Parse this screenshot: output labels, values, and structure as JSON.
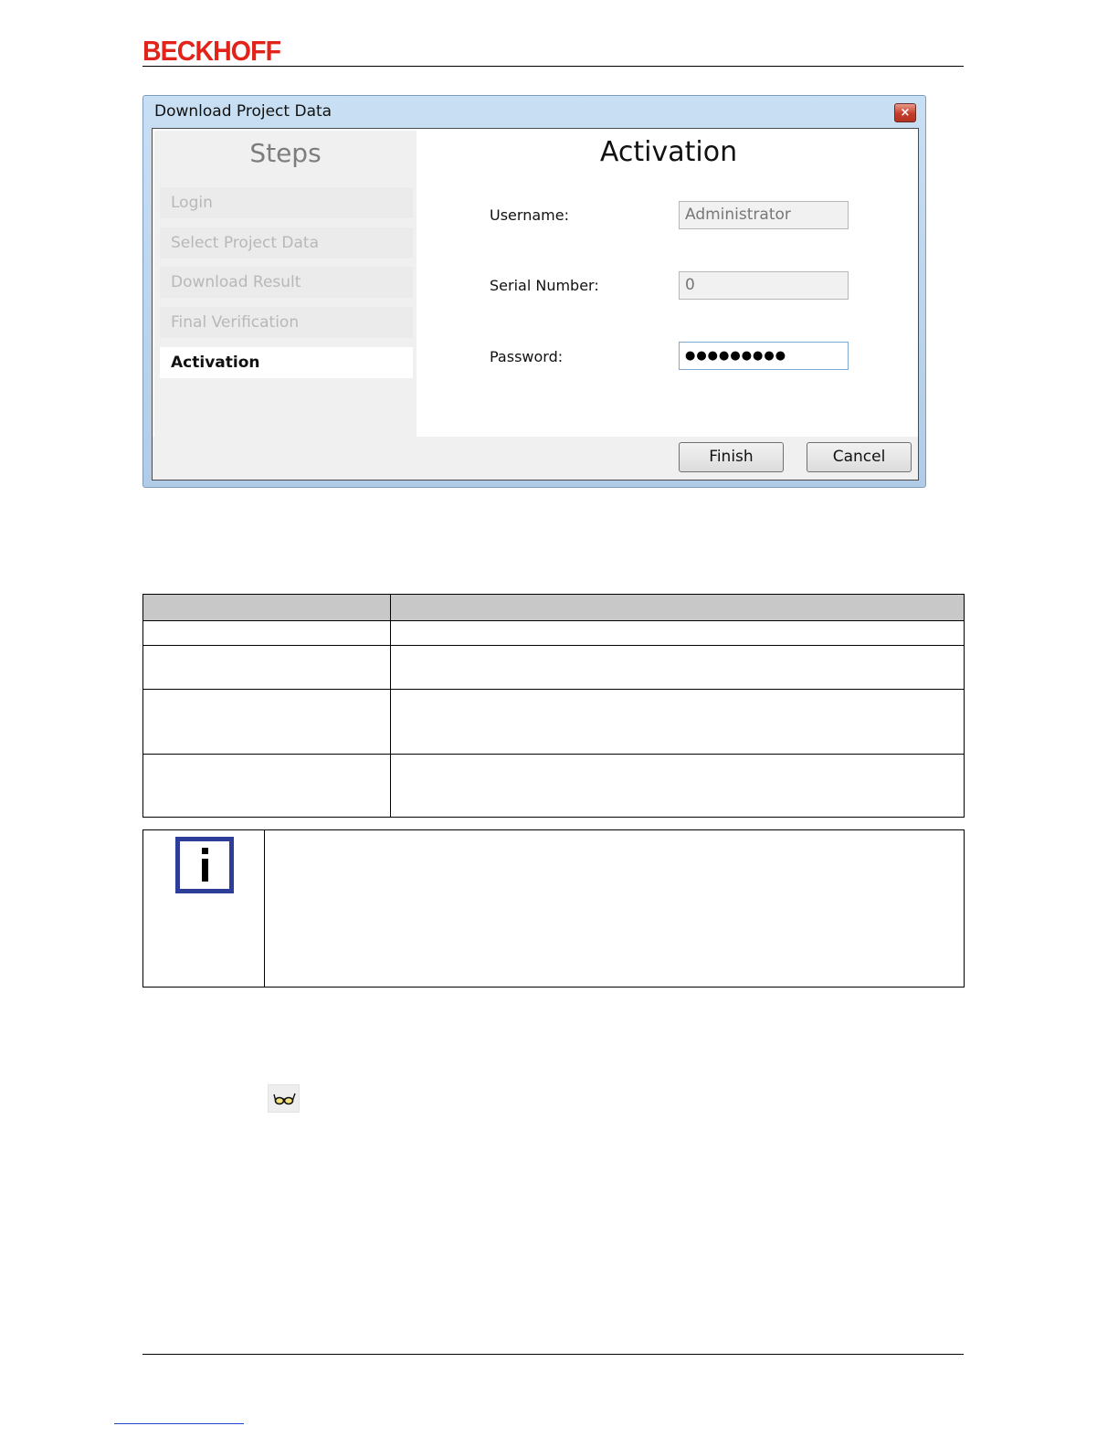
{
  "header": {
    "logo": "BECKHOFF"
  },
  "dialog": {
    "title": "Download Project Data",
    "close_glyph": "×",
    "steps_title": "Steps",
    "steps": [
      {
        "label": "Login",
        "state": "disabled"
      },
      {
        "label": "Select Project Data",
        "state": "disabled"
      },
      {
        "label": "Download Result",
        "state": "disabled"
      },
      {
        "label": "Final Verification",
        "state": "disabled"
      },
      {
        "label": "Activation",
        "state": "active"
      }
    ],
    "form_title": "Activation",
    "fields": {
      "username": {
        "label": "Username:",
        "value": "Administrator"
      },
      "serial": {
        "label": "Serial Number:",
        "value": "0"
      },
      "password": {
        "label": "Password:",
        "value": "●●●●●●●●●"
      }
    },
    "buttons": {
      "finish": "Finish",
      "cancel": "Cancel"
    }
  },
  "icons": {
    "note": "info-icon",
    "inline": "glasses-icon"
  },
  "colors": {
    "logo": "#e2231a",
    "info_icon_border": "#2e3d97",
    "table_header": "#c8c8c8"
  }
}
